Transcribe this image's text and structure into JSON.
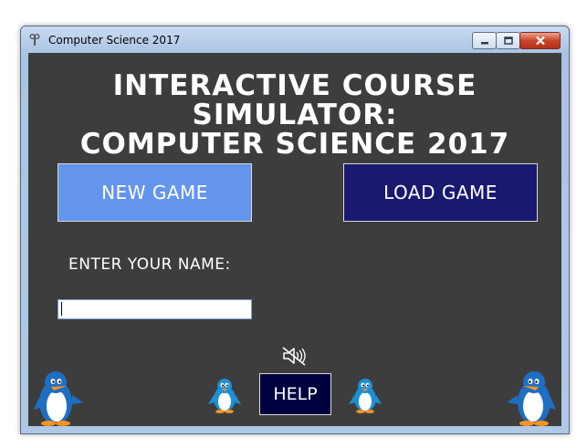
{
  "window": {
    "title": "Computer Science 2017",
    "controls": {
      "minimize": "minimize",
      "maximize": "maximize",
      "close": "close"
    }
  },
  "game": {
    "title_line1": "INTERACTIVE COURSE SIMULATOR:",
    "title_line2": "COMPUTER SCIENCE 2017",
    "new_game_label": "NEW GAME",
    "load_game_label": "LOAD GAME",
    "name_label": "ENTER YOUR NAME:",
    "name_value": "",
    "help_label": "HELP",
    "sound_icon": "speaker-muted-icon",
    "decorations": [
      "penguin-icon",
      "penguin-icon",
      "penguin-icon",
      "penguin-icon"
    ]
  },
  "colors": {
    "background": "#3d3d3d",
    "new_game": "#6495ed",
    "load_game": "#191970",
    "help": "#000040",
    "penguin_blue": "#1e8fd6"
  }
}
